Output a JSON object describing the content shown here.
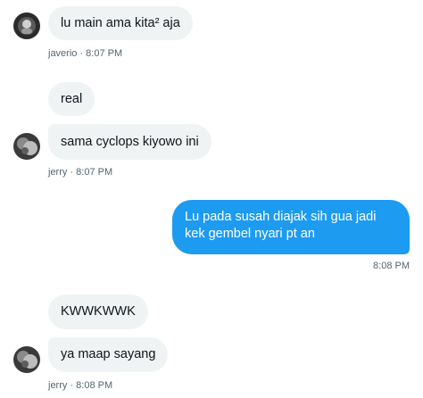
{
  "conversation": {
    "messages": [
      {
        "sender": "javerio",
        "text": "lu main ama kita² aja"
      },
      {
        "sender": "jerry",
        "text": "real"
      },
      {
        "sender": "jerry",
        "text": "sama cyclops kiyowo ini"
      },
      {
        "sender": "me",
        "text": "Lu pada susah diajak sih gua jadi kek gembel nyari pt an"
      },
      {
        "sender": "jerry",
        "text": "KWWKWWK"
      },
      {
        "sender": "jerry",
        "text": "ya maap sayang"
      }
    ],
    "meta": [
      {
        "text": "javerio · 8:07 PM"
      },
      {
        "text": "jerry · 8:07 PM"
      },
      {
        "text": "8:08 PM"
      },
      {
        "text": "jerry · 8:08 PM"
      }
    ]
  }
}
